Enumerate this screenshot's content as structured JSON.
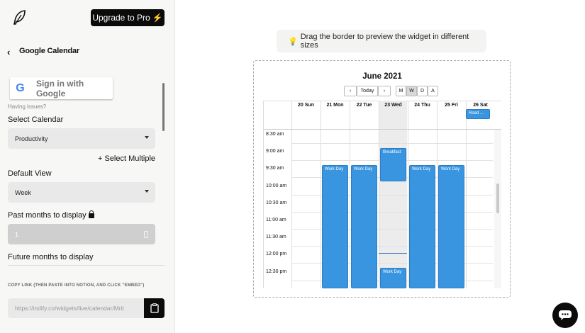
{
  "sidebar": {
    "upgrade_label": "Upgrade to Pro",
    "upgrade_icon": "lightning-icon",
    "header_title": "Google Calendar",
    "google_signin_label": "Sign in with Google",
    "issues_text": "Having issues?",
    "select_calendar_label": "Select Calendar",
    "calendar_value": "Productivity",
    "select_multiple_label": "+ Select Multiple",
    "default_view_label": "Default View",
    "default_view_value": "Week",
    "past_months_label": "Past months to display",
    "past_months_value": "1",
    "future_months_label": "Future months to display",
    "copy_link_label": "COPY LINK (THEN PASTE INTO NOTION, AND CLICK \"EMBED\")",
    "link_value": "https://indify.co/widgets/live/calendar/Mrit"
  },
  "main": {
    "hint_text": "Drag the border to preview the widget in different sizes"
  },
  "calendar": {
    "month": "June 2021",
    "today_label": "Today",
    "prev_label": "‹",
    "next_label": "›",
    "view_m": "M",
    "view_w": "W",
    "view_d": "D",
    "view_a": "A",
    "active_view": "W",
    "days": [
      "20 Sun",
      "21 Mon",
      "22 Tue",
      "23 Wed",
      "24 Thu",
      "25 Fri",
      "26 Sat"
    ],
    "today_day": "23 Wed",
    "times": [
      "8:30 am",
      "9:00 am",
      "9:30 am",
      "10:00 am",
      "10:30 am",
      "11:00 am",
      "11:30 am",
      "12:00 pm",
      "12:30 pm"
    ],
    "allday_event": "Road ...",
    "events": [
      {
        "day": "21 Mon",
        "title": "Work Day"
      },
      {
        "day": "22 Tue",
        "title": "Work Day"
      },
      {
        "day": "23 Wed",
        "title": "Breakfast"
      },
      {
        "day": "23 Wed",
        "title": "Work Day"
      },
      {
        "day": "24 Thu",
        "title": "Work Day"
      },
      {
        "day": "25 Fri",
        "title": "Work Day"
      }
    ],
    "event_color": "#3a95e0"
  }
}
